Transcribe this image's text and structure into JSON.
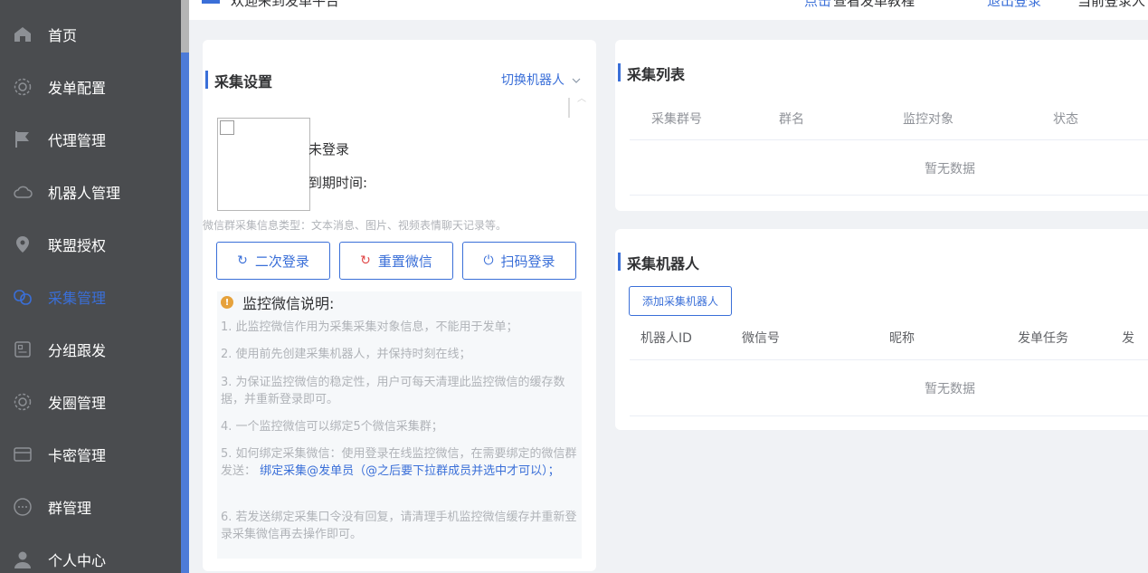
{
  "header": {
    "welcome": "欢迎来到发单平台",
    "tip_link": "点击",
    "tip_text": "查看发单教程",
    "logout": "退出登录",
    "current_user": "当前登录人"
  },
  "sidebar": {
    "items": [
      {
        "label": "首页",
        "icon": "home-icon"
      },
      {
        "label": "发单配置",
        "icon": "gear-icon"
      },
      {
        "label": "代理管理",
        "icon": "flag-icon"
      },
      {
        "label": "机器人管理",
        "icon": "cloud-icon"
      },
      {
        "label": "联盟授权",
        "icon": "location-pin-icon"
      },
      {
        "label": "采集管理",
        "icon": "link-icon",
        "active": true
      },
      {
        "label": "分组跟发",
        "icon": "grid-icon"
      },
      {
        "label": "发圈管理",
        "icon": "settings-icon"
      },
      {
        "label": "卡密管理",
        "icon": "card-icon"
      },
      {
        "label": "群管理",
        "icon": "chat-icon"
      },
      {
        "label": "个人中心",
        "icon": "user-icon"
      }
    ]
  },
  "collect_settings": {
    "title": "采集设置",
    "switch_robot": "切换机器人",
    "login_status": "未登录",
    "expire_label": "到期时间:",
    "info_type": "微信群采集信息类型：文本消息、图片、视频表情聊天记录等。",
    "buttons": {
      "relogin": "二次登录",
      "reset": "重置微信",
      "scan": "扫码登录"
    },
    "notice_title": "监控微信说明:",
    "notes": {
      "n1": "1. 此监控微信作用为采集采集对象信息，不能用于发单；",
      "n2": "2. 使用前先创建采集机器人，并保持时刻在线；",
      "n3": "3. 为保证监控微信的稳定性，用户可每天清理此监控微信的缓存数据，并重新登录即可。",
      "n4": "4. 一个监控微信可以绑定5个微信采集群；",
      "n5_prefix": "5. 如何绑定采集微信：使用登录在线监控微信，在需要绑定的微信群发送：",
      "n5_highlight": "绑定采集@发单员（@之后要下拉群成员并选中才可以）；",
      "n6": "6. 若发送绑定采集口令没有回复，请清理手机监控微信缓存并重新登录采集微信再去操作即可。"
    }
  },
  "collect_list": {
    "title": "采集列表",
    "columns": [
      "采集群号",
      "群名",
      "监控对象",
      "状态"
    ],
    "empty": "暂无数据"
  },
  "collect_robot": {
    "title": "采集机器人",
    "add_button": "添加采集机器人",
    "columns": [
      "机器人ID",
      "微信号",
      "昵称",
      "发单任务",
      "发"
    ],
    "empty": "暂无数据"
  },
  "colors": {
    "accent": "#3a6fd8",
    "sidebar_bg": "#4a4c4f",
    "warning": "#e6a23c"
  }
}
